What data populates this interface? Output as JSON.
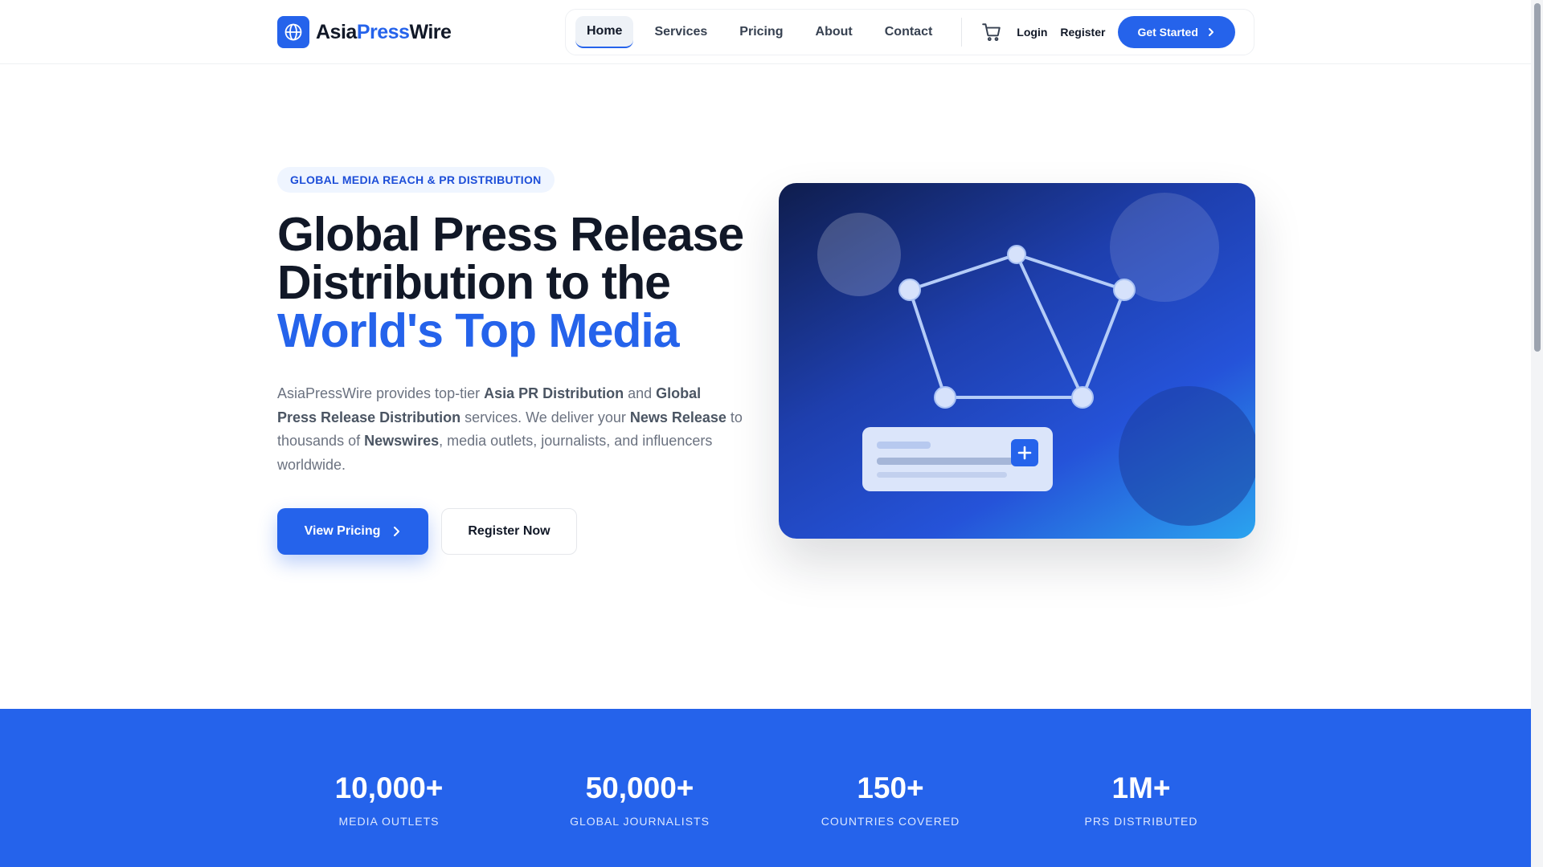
{
  "header": {
    "brand": {
      "part1": "Asia",
      "part2": "Press",
      "part3": "Wire"
    },
    "nav": [
      {
        "label": "Home",
        "active": true
      },
      {
        "label": "Services"
      },
      {
        "label": "Pricing"
      },
      {
        "label": "About"
      },
      {
        "label": "Contact"
      }
    ],
    "login_label": "Login",
    "register_label": "Register",
    "cta_label": "Get Started"
  },
  "hero": {
    "badge": "GLOBAL MEDIA REACH & PR DISTRIBUTION",
    "title_line1": "Global Press Release",
    "title_line2": "Distribution to the",
    "title_line3": "World's Top Media",
    "desc": {
      "t1": "AsiaPressWire provides top-tier ",
      "b1": "Asia PR Distribution",
      "t2": " and ",
      "b2": "Global Press Release Distribution",
      "t3": " services. We deliver your ",
      "b3": "News Release",
      "t4": " to thousands of ",
      "b4": "Newswires",
      "t5": ", media outlets, journalists, and influencers worldwide."
    },
    "primary_button": "View Pricing",
    "secondary_button": "Register Now"
  },
  "stats": [
    {
      "value": "10,000+",
      "label": "MEDIA OUTLETS"
    },
    {
      "value": "50,000+",
      "label": "GLOBAL JOURNALISTS"
    },
    {
      "value": "150+",
      "label": "COUNTRIES COVERED"
    },
    {
      "value": "1M+",
      "label": "PRS DISTRIBUTED"
    }
  ],
  "colors": {
    "brand": "#2563eb",
    "text": "#111827",
    "muted": "#6b7280"
  },
  "icons": [
    "globe-icon",
    "cart-icon",
    "chevron-right-icon",
    "plus-icon"
  ]
}
